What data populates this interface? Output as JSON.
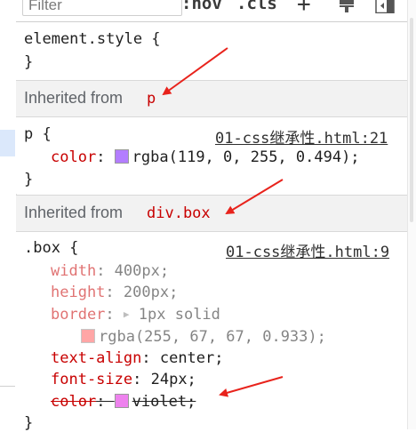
{
  "toolbar": {
    "filter_placeholder": "Filter",
    "hov_label": ":hov",
    "cls_label": ".cls",
    "plus_label": "+"
  },
  "element_style": {
    "selector_line": "element.style {",
    "close": "}"
  },
  "inherited_p": {
    "label": "Inherited from",
    "selector": "p"
  },
  "rule_p": {
    "selector": "p {",
    "source": "01-css继承性.html:21",
    "decl_prop": "color",
    "decl_value": "rgba(119, 0, 255, 0.494);",
    "swatch_color": "#b37dff",
    "close": "}"
  },
  "inherited_box": {
    "label": "Inherited from",
    "selector": "div.box"
  },
  "rule_box": {
    "selector": ".box {",
    "source": "01-css继承性.html:9",
    "width_prop": "width",
    "width_value": "400px;",
    "height_prop": "height",
    "height_value": "200px;",
    "border_prop": "border",
    "border_value": "1px solid",
    "border_color_value": "rgba(255, 67, 67, 0.933);",
    "border_swatch": "#ff5e5e",
    "text_align_prop": "text-align",
    "text_align_value": "center;",
    "font_size_prop": "font-size",
    "font_size_value": "24px;",
    "color_prop": "color",
    "color_value": "violet;",
    "color_swatch": "#ee82ee",
    "close": "}"
  },
  "colors": {
    "property_red": "#c80000",
    "annotation_arrow": "#e8231c"
  }
}
